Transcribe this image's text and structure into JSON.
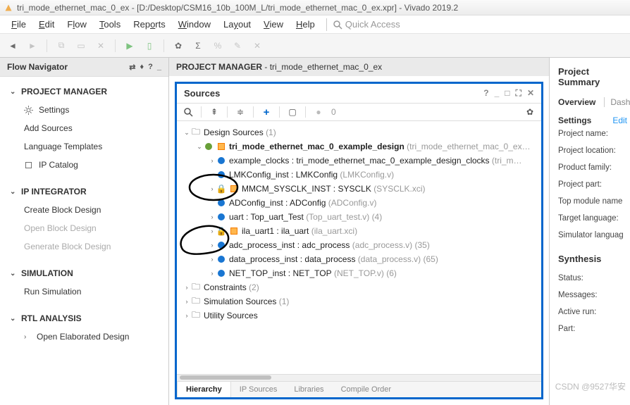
{
  "title": "tri_mode_ethernet_mac_0_ex - [D:/Desktop/CSM16_10b_100M_L/tri_mode_ethernet_mac_0_ex.xpr] - Vivado 2019.2",
  "menus": {
    "file": "File",
    "edit": "Edit",
    "flow": "Flow",
    "tools": "Tools",
    "reports": "Reports",
    "window": "Window",
    "layout": "Layout",
    "view": "View",
    "help": "Help"
  },
  "quick_access_placeholder": "Quick Access",
  "nav": {
    "title": "Flow Navigator",
    "sections": {
      "project_manager": "PROJECT MANAGER",
      "ip_integrator": "IP INTEGRATOR",
      "simulation": "SIMULATION",
      "rtl_analysis": "RTL ANALYSIS"
    },
    "items": {
      "settings": "Settings",
      "add_sources": "Add Sources",
      "language_templates": "Language Templates",
      "ip_catalog": "IP Catalog",
      "create_block_design": "Create Block Design",
      "open_block_design": "Open Block Design",
      "generate_block_design": "Generate Block Design",
      "run_simulation": "Run Simulation",
      "open_elaborated_design": "Open Elaborated Design"
    }
  },
  "pm_header_prefix": "PROJECT MANAGER",
  "pm_header_name": "tri_mode_ethernet_mac_0_ex",
  "sources": {
    "title": "Sources",
    "count": "0",
    "tabs": {
      "hierarchy": "Hierarchy",
      "ip_sources": "IP Sources",
      "libraries": "Libraries",
      "compile_order": "Compile Order"
    },
    "tree": {
      "design_sources": "Design Sources",
      "design_sources_count": "(1)",
      "top": "tri_mode_ethernet_mac_0_example_design",
      "top_suffix": "(tri_mode_ethernet_mac_0_ex…",
      "r1": "example_clocks : tri_mode_ethernet_mac_0_example_design_clocks",
      "r1_suffix": "(tri_m…",
      "r2": "LMKConfig_inst : LMKConfig",
      "r2_suffix": "(LMKConfig.v)",
      "r3": "MMCM_SYSCLK_INST : SYSCLK",
      "r3_suffix": "(SYSCLK.xci)",
      "r4": "ADConfig_inst : ADConfig",
      "r4_suffix": "(ADConfig.v)",
      "r5": "uart : Top_uart_Test",
      "r5_suffix": "(Top_uart_test.v) (4)",
      "r6": "ila_uart1 : ila_uart",
      "r6_suffix": "(ila_uart.xci)",
      "r7": "adc_process_inst : adc_process",
      "r7_suffix": "(adc_process.v) (35)",
      "r8": "data_process_inst : data_process",
      "r8_suffix": "(data_process.v) (65)",
      "r9": "NET_TOP_inst : NET_TOP",
      "r9_suffix": "(NET_TOP.v) (6)",
      "constraints": "Constraints",
      "constraints_count": "(2)",
      "sim_sources": "Simulation Sources",
      "sim_sources_count": "(1)",
      "utility_sources": "Utility Sources"
    }
  },
  "summary": {
    "title": "Project Summary",
    "overview": "Overview",
    "dashboard": "Dashb",
    "settings": "Settings",
    "edit": "Edit",
    "fields": {
      "project_name": "Project name:",
      "project_location": "Project location:",
      "product_family": "Product family:",
      "project_part": "Project part:",
      "top_module": "Top module name",
      "target_language": "Target language:",
      "simulator_language": "Simulator languag"
    },
    "synthesis": "Synthesis",
    "status": "Status:",
    "messages": "Messages:",
    "active_run": "Active run:",
    "part": "Part:"
  },
  "watermark": "CSDN @9527华安"
}
